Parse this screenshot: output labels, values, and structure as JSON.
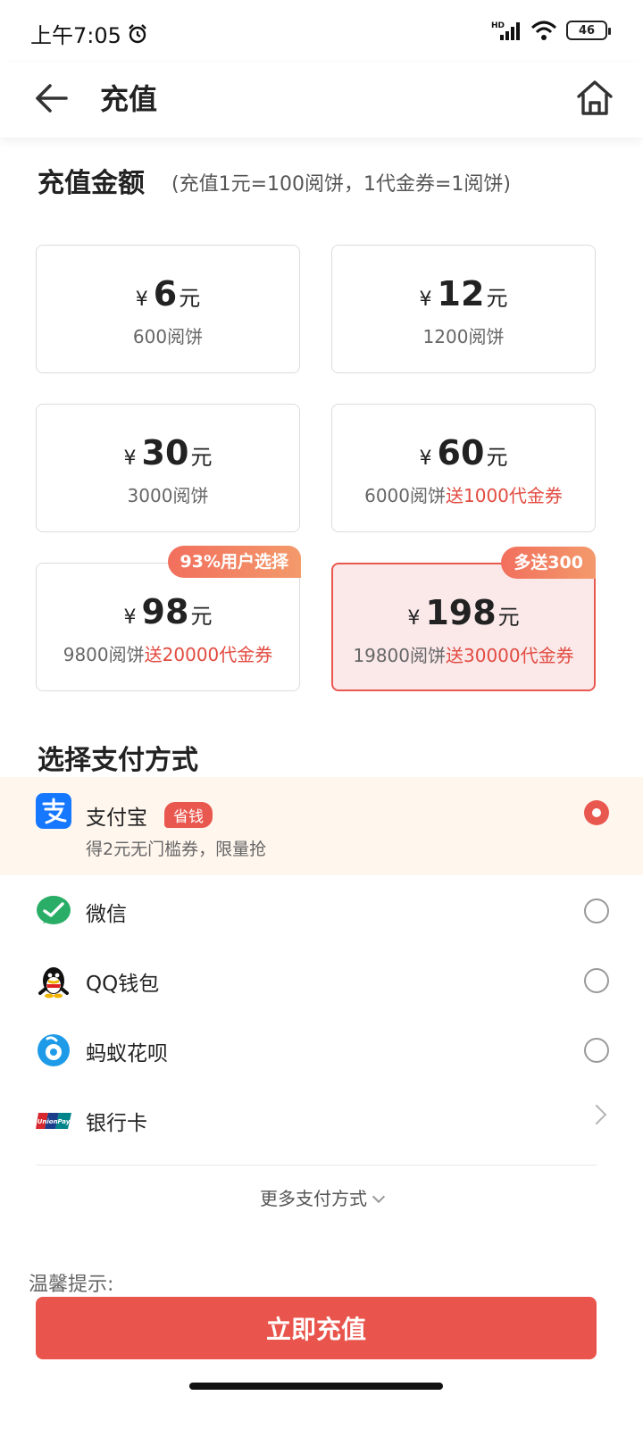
{
  "status_bar": {
    "time": "上午7:05",
    "network": "HD",
    "battery": "46"
  },
  "header": {
    "title": "充值"
  },
  "amount_section": {
    "title": "充值金额",
    "note": "(充值1元=100阅饼，1代金券=1阅饼)",
    "currency_symbol": "¥",
    "unit": "元",
    "cards": [
      {
        "amount": "6",
        "points": "600阅饼",
        "bonus": "",
        "tag": "",
        "selected": false
      },
      {
        "amount": "12",
        "points": "1200阅饼",
        "bonus": "",
        "tag": "",
        "selected": false
      },
      {
        "amount": "30",
        "points": "3000阅饼",
        "bonus": "",
        "tag": "",
        "selected": false
      },
      {
        "amount": "60",
        "points": "6000阅饼",
        "bonus": "送1000代金券",
        "tag": "",
        "selected": false
      },
      {
        "amount": "98",
        "points": "9800阅饼",
        "bonus": "送20000代金券",
        "tag": "93%用户选择",
        "selected": false
      },
      {
        "amount": "198",
        "points": "19800阅饼",
        "bonus": "送30000代金券",
        "tag": "多送300",
        "selected": true
      }
    ]
  },
  "payment_section": {
    "title": "选择支付方式",
    "methods": [
      {
        "label": "支付宝",
        "badge": "省钱",
        "sub": "得2元无门槛券，限量抢",
        "icon": "alipay-icon",
        "control": "radio",
        "checked": true
      },
      {
        "label": "微信",
        "icon": "wechat-icon",
        "control": "radio",
        "checked": false
      },
      {
        "label": "QQ钱包",
        "icon": "qq-icon",
        "control": "radio",
        "checked": false
      },
      {
        "label": "蚂蚁花呗",
        "icon": "huabei-icon",
        "control": "radio",
        "checked": false
      },
      {
        "label": "银行卡",
        "icon": "unionpay-icon",
        "control": "chevron"
      }
    ],
    "more_label": "更多支付方式",
    "unionpay_text": "UnionPay"
  },
  "footer": {
    "tip_label": "温馨提示:",
    "submit_label": "立即充值"
  },
  "colors": {
    "accent": "#e9554c",
    "selected_bg": "#fbe9ea",
    "highlight_bg": "#fff6ee",
    "bonus_text": "#e24b40"
  }
}
